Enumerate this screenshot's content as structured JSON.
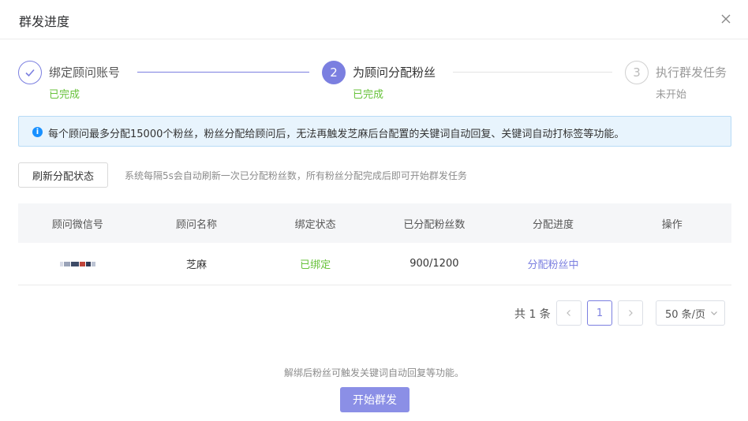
{
  "dialog": {
    "title": "群发进度"
  },
  "steps": [
    {
      "title": "绑定顾问账号",
      "status": "已完成",
      "state": "done"
    },
    {
      "number": "2",
      "title": "为顾问分配粉丝",
      "status": "已完成",
      "state": "active"
    },
    {
      "number": "3",
      "title": "执行群发任务",
      "status": "未开始",
      "state": "wait"
    }
  ],
  "alert": {
    "text": "每个顾问最多分配15000个粉丝，粉丝分配给顾问后，无法再触发芝麻后台配置的关键词自动回复、关键词自动打标签等功能。"
  },
  "toolbar": {
    "refresh_label": "刷新分配状态",
    "refresh_note": "系统每隔5s会自动刷新一次已分配粉丝数，所有粉丝分配完成后即可开始群发任务"
  },
  "table": {
    "columns": [
      "顾问微信号",
      "顾问名称",
      "绑定状态",
      "已分配粉丝数",
      "分配进度",
      "操作"
    ],
    "rows": [
      {
        "name": "芝麻",
        "status": "已绑定",
        "fans": "900/1200",
        "progress": "分配粉丝中",
        "action": ""
      }
    ]
  },
  "pagination": {
    "total": "共 1 条",
    "prev": "<",
    "current_page": "1",
    "next": ">",
    "page_size": "50 条/页"
  },
  "footer": {
    "note": "解绑后粉丝可触发关键词自动回复等功能。",
    "start_label": "开始群发"
  },
  "colors": {
    "accent": "#7b7fe0",
    "success": "#67c23a",
    "info": "#1890ff",
    "start_button": "#8b8fe6"
  }
}
